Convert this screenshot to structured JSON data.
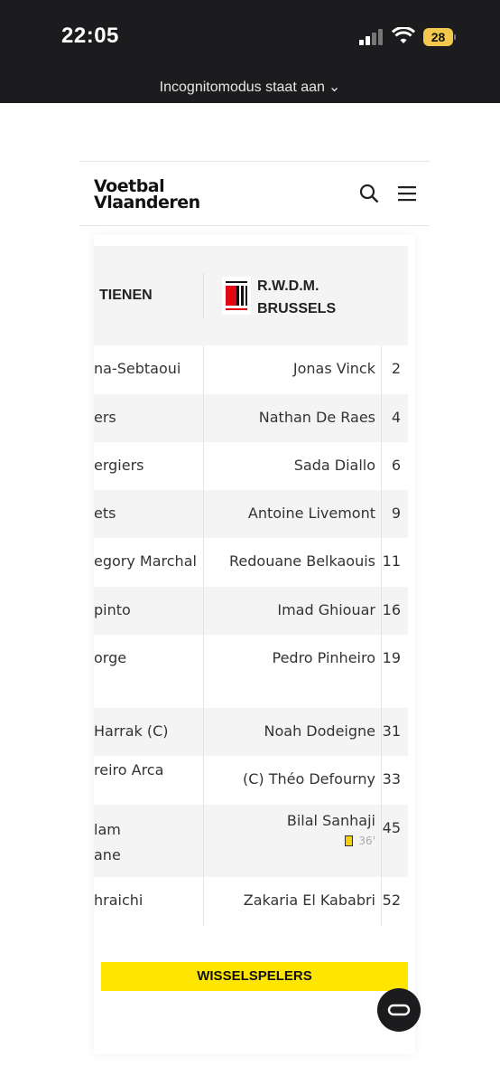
{
  "status_bar": {
    "time": "22:05",
    "battery": "28"
  },
  "browser": {
    "incognito_label": "Incognitomodus staat aan"
  },
  "site": {
    "logo_line1": "Voetbal",
    "logo_line2": "Vlaanderen"
  },
  "teams": {
    "home_name": "TIENEN",
    "away_name_line1": "R.W.D.M.",
    "away_name_line2": "BRUSSELS"
  },
  "lineup": [
    {
      "home": "na-Sebtaoui",
      "away": "Jonas Vinck",
      "number": "2"
    },
    {
      "home": "ers",
      "away": "Nathan De Raes",
      "number": "4"
    },
    {
      "home": "ergiers",
      "away": "Sada Diallo",
      "number": "6"
    },
    {
      "home": "ets",
      "away": "Antoine Livemont",
      "number": "9"
    },
    {
      "home": "egory Marchal",
      "away": "Redouane Belkaouis",
      "number": "11"
    },
    {
      "home": "pinto",
      "away": "Imad Ghiouar",
      "number": "16"
    },
    {
      "home": "orge",
      "away": "Pedro Pinheiro",
      "number": "19"
    },
    {
      "home": "Harrak (C)",
      "away": "Noah Dodeigne",
      "number": "31"
    },
    {
      "home": "reiro Arca",
      "away": "(C) Théo Defourny",
      "number": "33"
    },
    {
      "home_line1": "lam",
      "home_line2": "ane",
      "away": "Bilal Sanhaji",
      "number": "45",
      "card_minute": "36'"
    },
    {
      "home": "hraichi",
      "away": "Zakaria El Kababri",
      "number": "52"
    }
  ],
  "subs_label": "WISSELSPELERS"
}
